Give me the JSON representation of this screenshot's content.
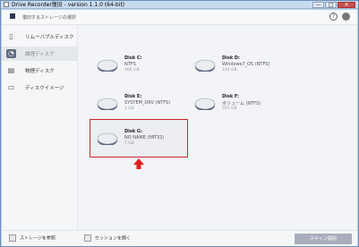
{
  "window": {
    "title": "Drive Recorder復旧 - version 1.1.0 (64-bit)",
    "minimize": "—",
    "maximize": "□",
    "close": "✕"
  },
  "header": {
    "title": "復旧するストレージの選択",
    "help_glyph": "?"
  },
  "sidebar": {
    "items": [
      {
        "label": "リムーバブルディスク",
        "icon": "sd-card-icon",
        "glyph": "▯"
      },
      {
        "label": "論理ディスク",
        "icon": "disk-icon",
        "glyph": "◔"
      },
      {
        "label": "物理ディスク",
        "icon": "hard-drive-icon",
        "glyph": "▤"
      },
      {
        "label": "ディスクイメージ",
        "icon": "image-file-icon",
        "glyph": "▭"
      }
    ]
  },
  "disks": [
    {
      "name": "Disk C:",
      "fs": "NTFS",
      "size": "466 GB"
    },
    {
      "name": "Disk D:",
      "fs": "Windows7_OS (NTFS)",
      "size": "102 GB"
    },
    {
      "name": "Disk E:",
      "fs": "SYSTEM_DRV (NTFS)",
      "size": "1 GB"
    },
    {
      "name": "Disk F:",
      "fs": "ボリューム (NTFS)",
      "size": "355 GB"
    },
    {
      "name": "Disk G:",
      "fs": "NO NAME (FAT32)",
      "size": "7 GB"
    }
  ],
  "footer": {
    "load_storage": "ストレージを参照",
    "open_session": "セッションを開く",
    "scan_start": "スキャン開始"
  },
  "colors": {
    "highlight": "#c9272b",
    "arrow": "#e02020",
    "scan_button": "#a9aebc"
  }
}
